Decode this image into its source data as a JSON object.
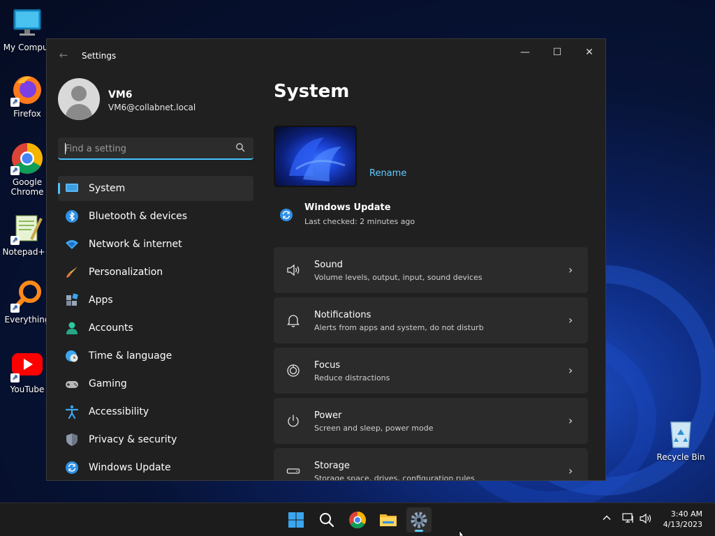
{
  "desktop": {
    "icons": [
      {
        "label": "My Comput"
      },
      {
        "label": "Firefox"
      },
      {
        "label": "Google Chrome"
      },
      {
        "label": "Notepad++"
      },
      {
        "label": "Everything"
      },
      {
        "label": "YouTube"
      },
      {
        "label": "Recycle Bin"
      }
    ]
  },
  "window": {
    "title": "Settings",
    "controls": {
      "minimize": "—",
      "maximize": "☐",
      "close": "✕"
    },
    "back_icon": "←"
  },
  "user": {
    "name": "VM6",
    "email": "VM6@collabnet.local"
  },
  "search": {
    "placeholder": "Find a setting",
    "value": ""
  },
  "nav": {
    "items": [
      {
        "label": "System",
        "icon": "monitor-icon",
        "selected": true
      },
      {
        "label": "Bluetooth & devices",
        "icon": "bluetooth-icon"
      },
      {
        "label": "Network & internet",
        "icon": "wifi-icon"
      },
      {
        "label": "Personalization",
        "icon": "brush-icon"
      },
      {
        "label": "Apps",
        "icon": "apps-icon"
      },
      {
        "label": "Accounts",
        "icon": "person-icon"
      },
      {
        "label": "Time & language",
        "icon": "globe-clock-icon"
      },
      {
        "label": "Gaming",
        "icon": "gamepad-icon"
      },
      {
        "label": "Accessibility",
        "icon": "accessibility-icon"
      },
      {
        "label": "Privacy & security",
        "icon": "shield-icon"
      },
      {
        "label": "Windows Update",
        "icon": "sync-icon"
      }
    ]
  },
  "main": {
    "title": "System",
    "rename_label": "Rename",
    "update": {
      "title": "Windows Update",
      "subtitle": "Last checked: 2 minutes ago"
    },
    "cards": [
      {
        "title": "Sound",
        "subtitle": "Volume levels, output, input, sound devices",
        "icon": "speaker-icon"
      },
      {
        "title": "Notifications",
        "subtitle": "Alerts from apps and system, do not disturb",
        "icon": "bell-icon"
      },
      {
        "title": "Focus",
        "subtitle": "Reduce distractions",
        "icon": "focus-icon"
      },
      {
        "title": "Power",
        "subtitle": "Screen and sleep, power mode",
        "icon": "power-icon"
      },
      {
        "title": "Storage",
        "subtitle": "Storage space, drives, configuration rules",
        "icon": "storage-icon"
      }
    ]
  },
  "taskbar": {
    "apps": [
      "start",
      "search",
      "chrome",
      "file-explorer",
      "settings"
    ],
    "active": "settings",
    "clock": {
      "time": "3:40 AM",
      "date": "4/13/2023"
    }
  },
  "colors": {
    "accent": "#4cc2ff",
    "link": "#60cdff",
    "window_bg": "#202020",
    "card_bg": "#2b2b2b"
  }
}
